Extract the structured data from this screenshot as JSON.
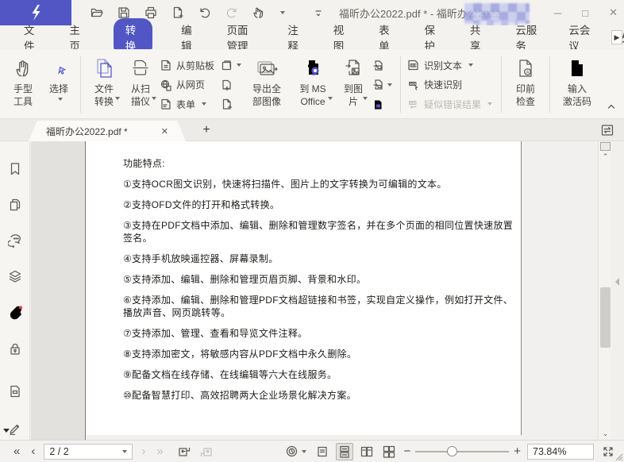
{
  "colors": {
    "accent": "#5156c4",
    "panel_grey": "#e2e1de",
    "canvas": "#f1f0ee"
  },
  "window": {
    "title": "福昕办公2022.pdf * - 福昕办公2022"
  },
  "menu_tabs": [
    "文件",
    "主页",
    "转换",
    "编辑",
    "页面管理",
    "注释",
    "视图",
    "表单",
    "保护",
    "共享",
    "云服务",
    "云会议",
    "放"
  ],
  "active_menu_tab": "转换",
  "ribbon": {
    "hand_tool": "手型\n工具",
    "select_label": "选择",
    "file_convert": "文件\n转换",
    "from_scanner": "从扫\n描仪",
    "from_clipboard": "从剪贴板",
    "from_web": "从网页",
    "form_label": "表单",
    "export_all_images": "导出全\n部图像",
    "to_ms_office": "到 MS\nOffice",
    "to_image": "到图\n片",
    "recognize_text": "识别文本",
    "quick_recognize": "快速识别",
    "suspected_error_results": "疑似错误结果",
    "preflight": "印前\n检查",
    "activation_code": "输入\n激活码"
  },
  "doc_tab": {
    "title": "福昕办公2022.pdf *"
  },
  "document": {
    "heading": "功能特点:",
    "lines": [
      "①支持OCR图文识别，快速将扫描件、图片上的文字转换为可编辑的文本。",
      "②支持OFD文件的打开和格式转换。",
      "③支持在PDF文档中添加、编辑、删除和管理数字签名，并在多个页面的相同位置快速放置签名。",
      "④支持手机放映遥控器、屏幕录制。",
      "⑤支持添加、编辑、删除和管理页眉页脚、背景和水印。",
      "⑥支持添加、编辑、删除和管理PDF文档超链接和书签，实现自定义操作，例如打开文件、播放声音、网页跳转等。",
      "⑦支持添加、管理、查看和导览文件注释。",
      "⑧支持添加密文，将敏感内容从PDF文档中永久删除。",
      "⑨配备文档在线存储、在线编辑等六大在线服务。",
      "⑩配备智慧打印、高效招聘两大企业场景化解决方案。"
    ]
  },
  "status_bar": {
    "page_display": "2 / 2",
    "zoom_percent": "73.84%"
  },
  "icon_names": {
    "quick_access": [
      "open-icon",
      "save-icon",
      "print-icon",
      "create-pdf-icon",
      "undo-icon",
      "redo-icon",
      "touch-mode-icon"
    ],
    "sidebar": [
      "bookmark-icon",
      "pages-icon",
      "comments-icon",
      "layers-icon",
      "attachment-icon",
      "security-icon",
      "destinations-icon",
      "signature-icon"
    ]
  }
}
